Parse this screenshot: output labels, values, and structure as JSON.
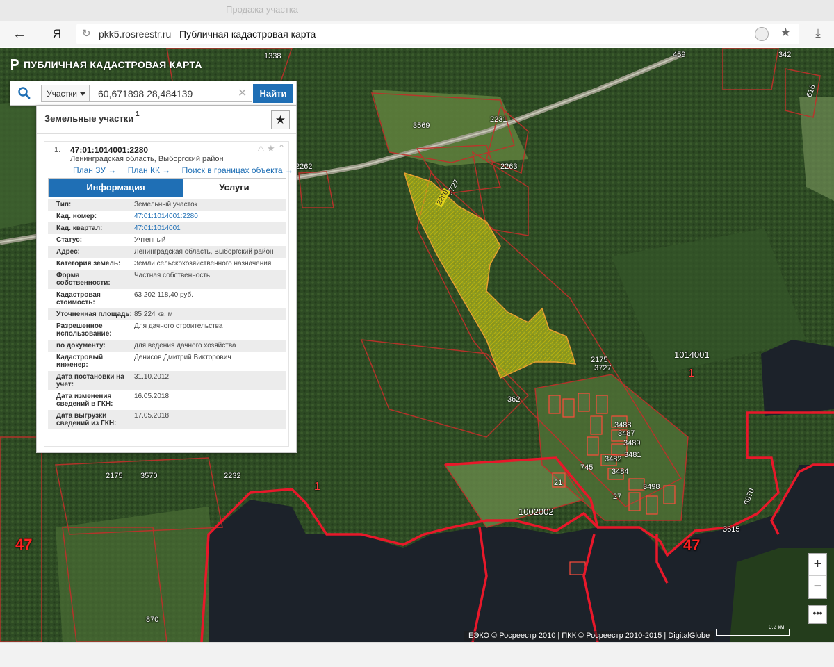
{
  "browser": {
    "tab_title": "Продажа участка",
    "back_icon": "arrow-left-icon",
    "yandex_label": "Я",
    "url": "pkk5.rosreestr.ru",
    "page_title": "Публичная кадастровая карта"
  },
  "app": {
    "title": "ПУБЛИЧНАЯ КАДАСТРОВАЯ КАРТА"
  },
  "search": {
    "type_label": "Участки",
    "query": "60,671898 28,484139",
    "find_label": "Найти"
  },
  "panel": {
    "title": "Земельные участки",
    "count": "1",
    "result": {
      "num": "1.",
      "id": "47:01:1014001:2280",
      "region": "Ленинградская область, Выборгский район",
      "links": [
        "План ЗУ →",
        "План КК →",
        "Поиск в границах объекта →"
      ],
      "tabs": [
        "Информация",
        "Услуги"
      ],
      "attributes": [
        {
          "k": "Тип:",
          "v": "Земельный участок"
        },
        {
          "k": "Кад. номер:",
          "v": "47:01:1014001:2280",
          "link": true
        },
        {
          "k": "Кад. квартал:",
          "v": "47:01:1014001",
          "link": true
        },
        {
          "k": "Статус:",
          "v": "Учтенный"
        },
        {
          "k": "Адрес:",
          "v": "Ленинградская область, Выборгский район"
        },
        {
          "k": "Категория земель:",
          "v": "Земли сельскохозяйственного назначения"
        },
        {
          "k": "Форма собственности:",
          "v": "Частная собственность"
        },
        {
          "k": "Кадастровая стоимость:",
          "v": "63 202 118,40 руб."
        },
        {
          "k": "Уточненная площадь:",
          "v": "85 224 кв. м"
        },
        {
          "k": "Разрешенное использование:",
          "v": "Для дачного строительства"
        },
        {
          "k": "по документу:",
          "v": "для ведения дачного хозяйства"
        },
        {
          "k": "Кадастровый инженер:",
          "v": "Денисов Дмитрий Викторович"
        },
        {
          "k": "Дата постановки на учет:",
          "v": "31.10.2012"
        },
        {
          "k": "Дата изменения сведений в ГКН:",
          "v": "16.05.2018"
        },
        {
          "k": "Дата выгрузки сведений из ГКН:",
          "v": "17.05.2018"
        }
      ]
    }
  },
  "map": {
    "attribution": "ЕЭКО © Росреестр 2010 | ПКК © Росреестр 2010-2015 | DigitalGlobe",
    "scale_label": "0.2 км",
    "zoom_in": "+",
    "zoom_out": "−",
    "more": "•••",
    "colors": {
      "forest": "#2d4a22",
      "field": "#5b7a3e",
      "water": "#1a1f26",
      "boundary": "#e8182a",
      "selected_fill": "#d4d41a"
    },
    "labels": [
      {
        "text": "1338",
        "size": 11
      },
      {
        "text": "3569",
        "size": 11
      },
      {
        "text": "2231",
        "size": 11
      },
      {
        "text": "2263",
        "size": 11
      },
      {
        "text": "2262",
        "size": 11
      },
      {
        "text": "3727",
        "size": 11
      },
      {
        "text": "2280",
        "size": 10
      },
      {
        "text": "2175",
        "size": 11
      },
      {
        "text": "3727",
        "size": 11
      },
      {
        "text": "1014001",
        "size": 13
      },
      {
        "text": "1",
        "size": 16
      },
      {
        "text": "362",
        "size": 11
      },
      {
        "text": "3570",
        "size": 11
      },
      {
        "text": "2175",
        "size": 11
      },
      {
        "text": "2232",
        "size": 11
      },
      {
        "text": "1002002",
        "size": 13
      },
      {
        "text": "1",
        "size": 16
      },
      {
        "text": "47",
        "size": 22
      },
      {
        "text": "47",
        "size": 22
      },
      {
        "text": "745",
        "size": 11
      },
      {
        "text": "3498",
        "size": 11
      },
      {
        "text": "3482",
        "size": 11
      },
      {
        "text": "3484",
        "size": 11
      },
      {
        "text": "3481",
        "size": 11
      },
      {
        "text": "3488",
        "size": 11
      },
      {
        "text": "3487",
        "size": 11
      },
      {
        "text": "3489",
        "size": 11
      },
      {
        "text": "3615",
        "size": 11
      },
      {
        "text": "6970",
        "size": 11
      },
      {
        "text": "870",
        "size": 11
      },
      {
        "text": "459",
        "size": 11
      },
      {
        "text": "342",
        "size": 11
      },
      {
        "text": "616",
        "size": 11
      },
      {
        "text": "27",
        "size": 11
      },
      {
        "text": "21",
        "size": 11
      }
    ]
  }
}
